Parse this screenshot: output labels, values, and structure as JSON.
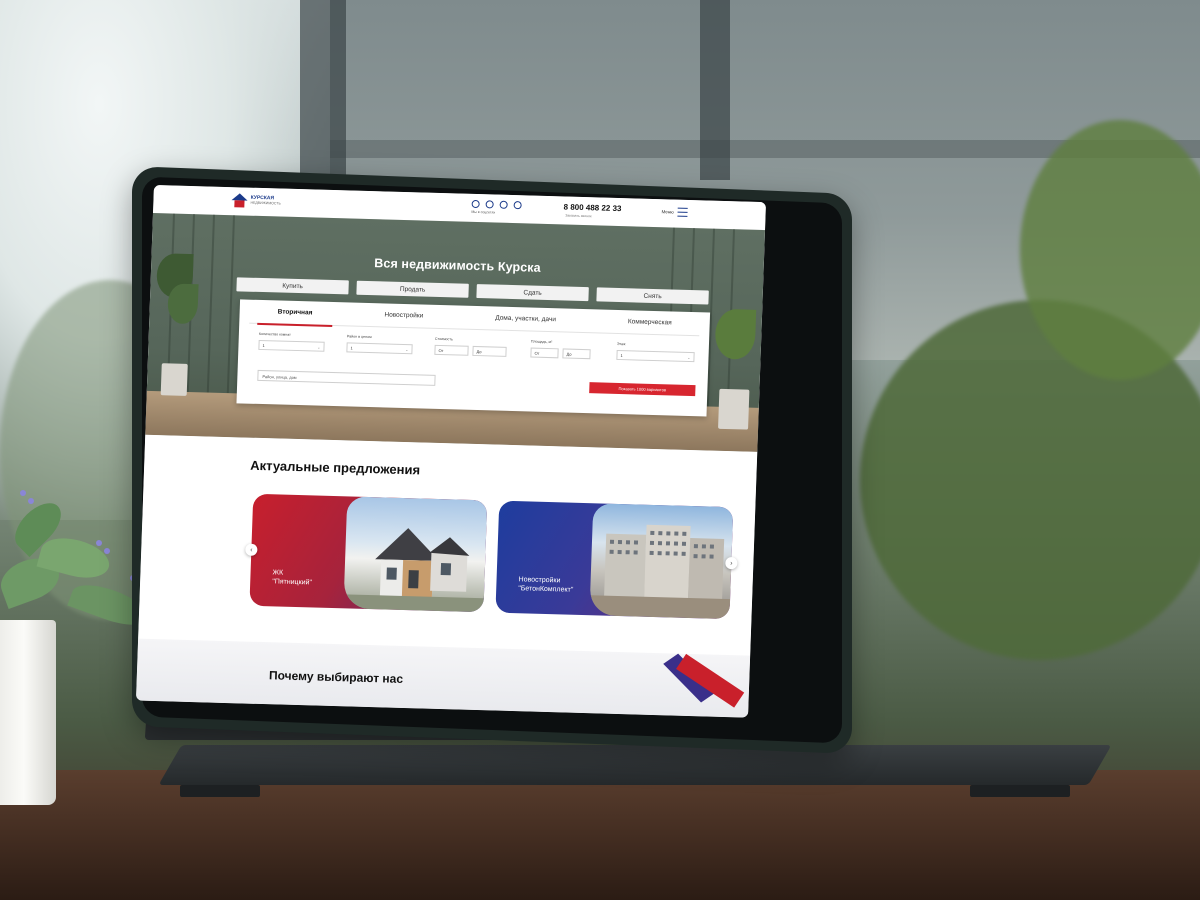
{
  "site": {
    "logo_line1": "КУРСКАЯ",
    "logo_line2": "НЕДВИЖИМОСТЬ",
    "social_label": "Мы в соцсетях",
    "phone": "8 800 488 22 33",
    "phone_sub": "Заказать звонок",
    "menu_label": "Меню"
  },
  "hero": {
    "title": "Вся недвижимость Курска",
    "deal_tabs": [
      "Купить",
      "Продать",
      "Сдать",
      "Снять"
    ],
    "type_tabs": [
      "Вторичная",
      "Новостройки",
      "Дома, участки, дачи",
      "Коммерческая"
    ],
    "filters": {
      "rooms_label": "Количество комнат",
      "rooms_value": "1",
      "district_label": "Район в целом",
      "district_value": "1",
      "price_label": "Стоимость",
      "price_from": "От",
      "price_to": "До",
      "area_label": "Площадь, м²",
      "area_from": "От",
      "area_to": "До",
      "floor_label": "Этаж",
      "floor_value": "1"
    },
    "address_placeholder": "Район, улица, дом",
    "show_button": "Показать 1000 вариантов"
  },
  "offers": {
    "title": "Актуальные предложения",
    "cards": [
      {
        "line1": "ЖК",
        "line2": "\"Пятницкий\""
      },
      {
        "line1": "Новостройки",
        "line2": "\"БетонКомплект\""
      }
    ]
  },
  "why": {
    "title": "Почему выбирают нас"
  },
  "colors": {
    "brand_red": "#c9202b",
    "brand_blue": "#1b3a8a"
  }
}
